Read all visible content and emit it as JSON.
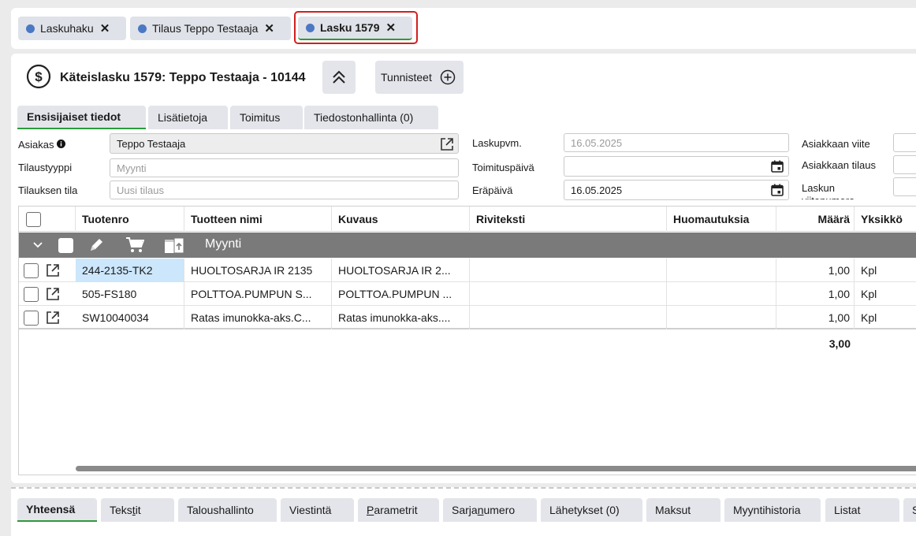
{
  "doc_tabs": [
    {
      "label": "Laskuhaku"
    },
    {
      "label": "Tilaus Teppo Testaaja"
    },
    {
      "label": "Lasku 1579"
    }
  ],
  "close_glyph": "✕",
  "header": {
    "title": "Käteislasku 1579: Teppo Testaaja - 10144",
    "tags_label": "Tunnisteet"
  },
  "sub_tabs": [
    "Ensisijaiset tiedot",
    "Lisätietoja",
    "Toimitus",
    "Tiedostonhallinta (0)"
  ],
  "form": {
    "customer_label": "Asiakas",
    "customer_value": "Teppo Testaaja",
    "order_type_label": "Tilaustyyppi",
    "order_type_placeholder": "Myynti",
    "order_status_label": "Tilauksen tila",
    "order_status_placeholder": "Uusi tilaus",
    "invoice_date_label": "Laskupvm.",
    "invoice_date_value": "16.05.2025",
    "delivery_date_label": "Toimituspäivä",
    "delivery_date_value": "",
    "due_date_label": "Eräpäivä",
    "due_date_value": "16.05.2025",
    "customer_ref_label": "Asiakkaan viite",
    "customer_order_label": "Asiakkaan tilaus",
    "invoice_ref_label": "Laskun viitenumero"
  },
  "grid": {
    "columns": [
      "Tuotenro",
      "Tuotteen nimi",
      "Kuvaus",
      "Riviteksti",
      "Huomautuksia",
      "Määrä",
      "Yksikkö"
    ],
    "group_label": "Myynti",
    "rows": [
      {
        "product_no": "244-2135-TK2",
        "name": "HUOLTOSARJA IR 2135",
        "description": "HUOLTOSARJA IR 2...",
        "row_text": "",
        "notes": "",
        "qty": "1,00",
        "unit": "Kpl"
      },
      {
        "product_no": "505-FS180",
        "name": "POLTTOA.PUMPUN S...",
        "description": "POLTTOA.PUMPUN ...",
        "row_text": "",
        "notes": "",
        "qty": "1,00",
        "unit": "Kpl"
      },
      {
        "product_no": "SW10040034",
        "name": "Ratas imunokka-aks.C...",
        "description": "Ratas imunokka-aks....",
        "row_text": "",
        "notes": "",
        "qty": "1,00",
        "unit": "Kpl"
      }
    ],
    "total_qty": "3,00"
  },
  "bottom_tabs": {
    "yhteensa": "Yhteensä",
    "tekstit_a": "Teks",
    "tekstit_u": "t",
    "tekstit_b": "it",
    "taloushallinto": "Taloushallinto",
    "viestinta": "Viestintä",
    "parametrit_u": "P",
    "parametrit_b": "arametrit",
    "sarjanumero_a": "Sarja",
    "sarjanumero_u": "n",
    "sarjanumero_b": "umero",
    "lahetykset": "Lähetykset (0)",
    "maksut": "Maksut",
    "myyntihistoria": "Myyntihistoria",
    "listat": "Listat",
    "more": "S"
  },
  "colors": {
    "accent_green": "#2e9a3b",
    "tab_dot": "#4a78c4",
    "highlight": "#d21f1f",
    "group_bg": "#7a7a7a",
    "selected_cell": "#cce6fb"
  }
}
